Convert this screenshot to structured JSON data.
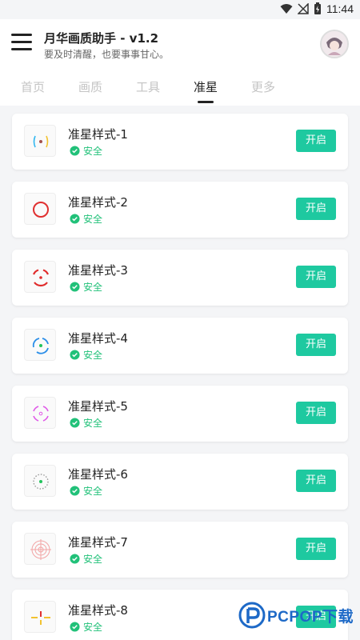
{
  "status_bar": {
    "time": "11:44"
  },
  "app_bar": {
    "title": "月华画质助手 - v1.2",
    "subtitle": "要及时清醒，也要事事甘心。"
  },
  "tabs": [
    {
      "label": "首页"
    },
    {
      "label": "画质"
    },
    {
      "label": "工具"
    },
    {
      "label": "准星",
      "active": true
    },
    {
      "label": "更多"
    }
  ],
  "crosshairs": [
    {
      "title": "准星样式-1",
      "status": "安全",
      "button": "开启"
    },
    {
      "title": "准星样式-2",
      "status": "安全",
      "button": "开启"
    },
    {
      "title": "准星样式-3",
      "status": "安全",
      "button": "开启"
    },
    {
      "title": "准星样式-4",
      "status": "安全",
      "button": "开启"
    },
    {
      "title": "准星样式-5",
      "status": "安全",
      "button": "开启"
    },
    {
      "title": "准星样式-6",
      "status": "安全",
      "button": "开启"
    },
    {
      "title": "准星样式-7",
      "status": "安全",
      "button": "开启"
    },
    {
      "title": "准星样式-8",
      "status": "安全",
      "button": "开启"
    }
  ],
  "watermark": {
    "text": "PCPOP下载"
  },
  "colors": {
    "accent": "#1ec9a0",
    "safe": "#21c179"
  }
}
